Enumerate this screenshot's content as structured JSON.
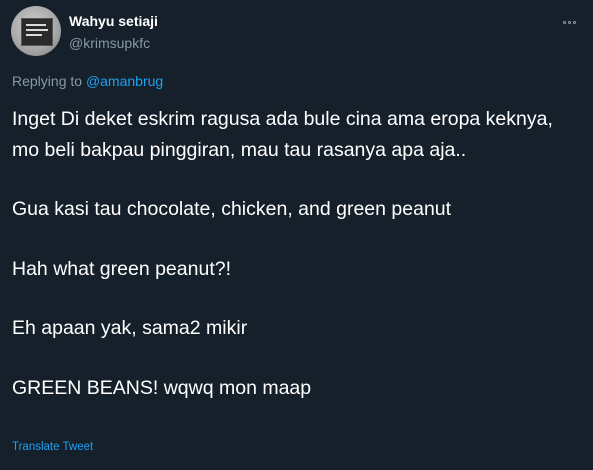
{
  "tweet": {
    "author_name": "Wahyu setiaji",
    "author_handle": "@krimsupkfc",
    "replying_prefix": "Replying to",
    "replying_mention": "@amanbrug",
    "paragraphs": [
      "Inget Di deket eskrim ragusa ada bule cina ama eropa keknya, mo beli bakpau pinggiran, mau tau rasanya apa aja..",
      "Gua kasi tau chocolate, chicken, and green peanut",
      "Hah what green peanut?!",
      "Eh apaan yak, sama2 mikir",
      "GREEN BEANS! wqwq mon maap"
    ],
    "translate_label": "Translate Tweet",
    "more_icon": "more-icon"
  },
  "colors": {
    "background": "#15202b",
    "text": "#ffffff",
    "secondary": "#8899a6",
    "accent": "#1da1f2"
  }
}
